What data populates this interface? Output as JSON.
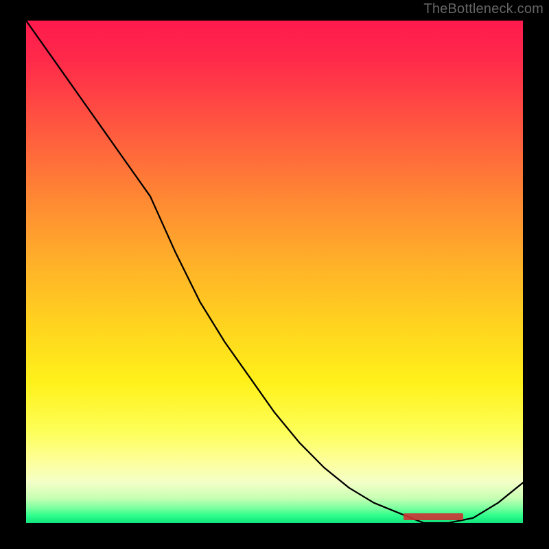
{
  "attribution": "TheBottleneck.com",
  "chart_data": {
    "type": "line",
    "x": [
      0.0,
      0.05,
      0.1,
      0.15,
      0.2,
      0.25,
      0.3,
      0.35,
      0.4,
      0.45,
      0.5,
      0.55,
      0.6,
      0.65,
      0.7,
      0.75,
      0.8,
      0.85,
      0.9,
      0.95,
      1.0
    ],
    "values": [
      100,
      93,
      86,
      79,
      72,
      65,
      54,
      44,
      36,
      29,
      22,
      16,
      11,
      7,
      4,
      2,
      0,
      0,
      1,
      4,
      8
    ],
    "xlim": [
      0,
      1
    ],
    "ylim": [
      0,
      100
    ],
    "title": "",
    "xlabel": "",
    "ylabel": "",
    "gradient_bg": true,
    "min_marker_range": [
      0.76,
      0.88
    ]
  },
  "colors": {
    "bg_top": "#ff1a4d",
    "bg_bottom": "#12e47e",
    "line": "#000000",
    "frame": "#000000",
    "marker": "#cc3333",
    "attribution_text": "#666666"
  }
}
